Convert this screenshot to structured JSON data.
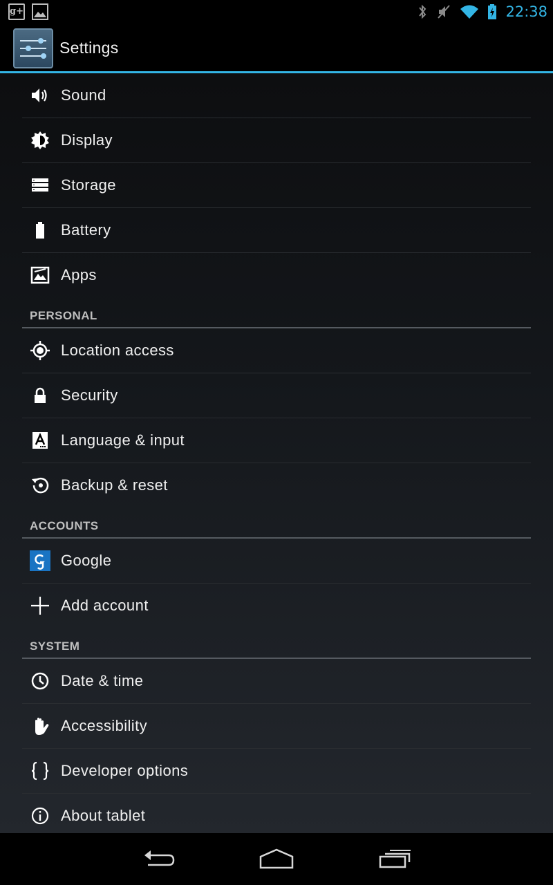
{
  "status_bar": {
    "time": "22:38",
    "notification_icons": [
      "google-plus-icon",
      "gallery-icon"
    ],
    "google_plus_glyph": "g+",
    "system_icons": [
      "bluetooth-icon",
      "mute-icon",
      "wifi-icon",
      "battery-charging-icon"
    ],
    "accent_color": "#33b5e5"
  },
  "action_bar": {
    "title": "Settings",
    "icon": "settings-sliders-icon"
  },
  "list": {
    "device": [
      {
        "label": "Sound",
        "icon": "sound-icon"
      },
      {
        "label": "Display",
        "icon": "display-icon"
      },
      {
        "label": "Storage",
        "icon": "storage-icon"
      },
      {
        "label": "Battery",
        "icon": "battery-icon"
      },
      {
        "label": "Apps",
        "icon": "apps-icon"
      }
    ],
    "personal": {
      "header": "PERSONAL",
      "items": [
        {
          "label": "Location access",
          "icon": "location-icon"
        },
        {
          "label": "Security",
          "icon": "lock-icon"
        },
        {
          "label": "Language & input",
          "icon": "language-icon"
        },
        {
          "label": "Backup & reset",
          "icon": "backup-icon"
        }
      ]
    },
    "accounts": {
      "header": "ACCOUNTS",
      "items": [
        {
          "label": "Google",
          "icon": "google-icon"
        },
        {
          "label": "Add account",
          "icon": "plus-icon"
        }
      ]
    },
    "system": {
      "header": "SYSTEM",
      "items": [
        {
          "label": "Date & time",
          "icon": "clock-icon"
        },
        {
          "label": "Accessibility",
          "icon": "hand-icon"
        },
        {
          "label": "Developer options",
          "icon": "braces-icon"
        },
        {
          "label": "About tablet",
          "icon": "info-icon"
        }
      ]
    }
  },
  "nav_bar": {
    "buttons": [
      "back-icon",
      "home-icon",
      "recent-apps-icon"
    ]
  }
}
